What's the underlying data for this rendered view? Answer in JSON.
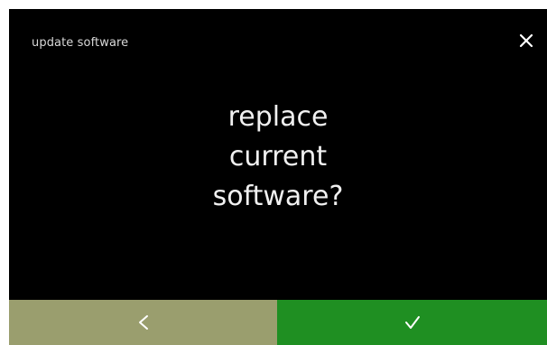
{
  "header": {
    "title": "update software",
    "close_icon": "close-icon"
  },
  "message": {
    "lines": [
      "replace",
      "current",
      "software?"
    ]
  },
  "footer": {
    "back_icon": "chevron-left-icon",
    "confirm_icon": "checkmark-icon"
  },
  "colors": {
    "screen_background": "#000000",
    "back_button": "#9a9e6e",
    "confirm_button": "#1f8f22",
    "text": "#f0f0f0"
  }
}
